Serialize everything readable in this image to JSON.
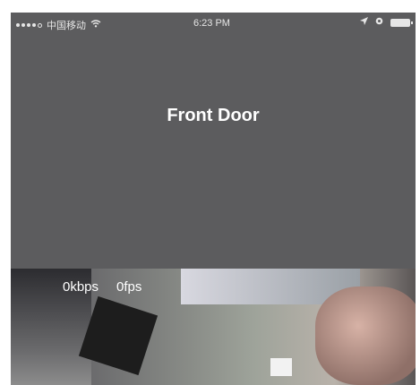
{
  "status_bar": {
    "carrier": "中国移动",
    "time": "6:23 PM"
  },
  "header": {
    "title": "Front Door"
  },
  "video": {
    "bitrate": "0kbps",
    "framerate": "0fps"
  }
}
